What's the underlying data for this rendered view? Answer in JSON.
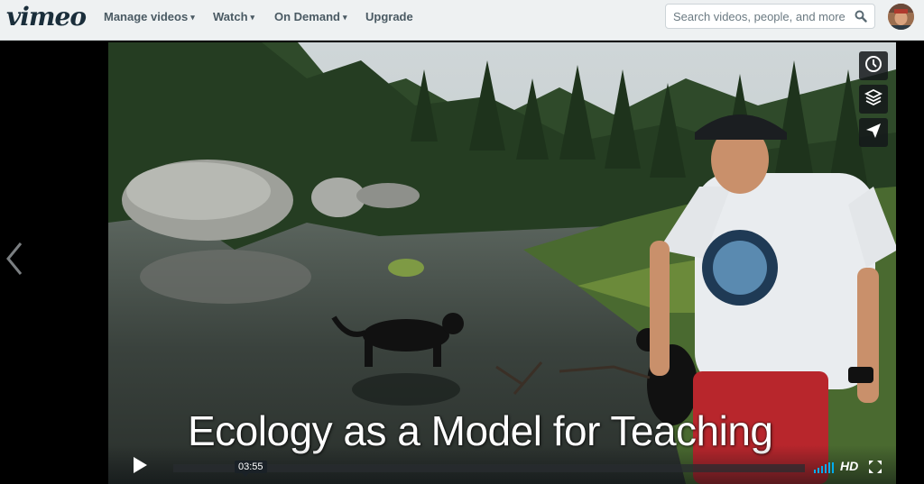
{
  "header": {
    "logo": "vimeo",
    "nav": [
      {
        "label": "Manage videos",
        "has_menu": true
      },
      {
        "label": "Watch",
        "has_menu": true
      },
      {
        "label": "On Demand",
        "has_menu": true
      },
      {
        "label": "Upgrade",
        "has_menu": false
      }
    ],
    "search": {
      "placeholder": "Search videos, people, and more",
      "value": "",
      "icon": "search-icon"
    },
    "avatar": "user-avatar"
  },
  "player": {
    "title_overlay": "Ecology as a Model for Teaching",
    "time_tooltip": "03:55",
    "quality_label": "HD",
    "side_buttons": [
      "watch-later-icon",
      "collections-icon",
      "share-icon"
    ],
    "nav_icon": "chevron-left-icon",
    "progress": 0.0
  },
  "colors": {
    "topbar": "#eef1f2",
    "nav_text": "#4a5a63",
    "logo": "#1a2e3b",
    "volume": "#00adef"
  }
}
